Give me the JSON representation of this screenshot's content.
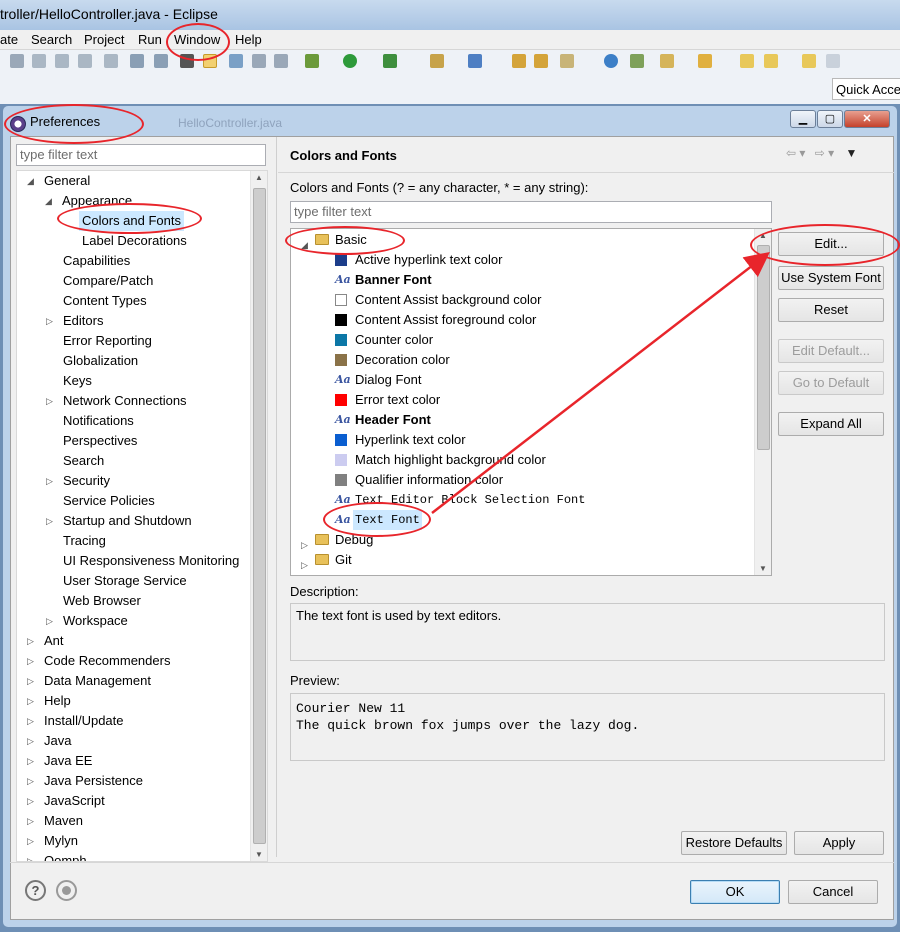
{
  "window": {
    "title": "troller/HelloController.java - Eclipse"
  },
  "menu": [
    "ate",
    "Search",
    "Project",
    "Run",
    "Window",
    "Help"
  ],
  "quick_access": "Quick Acce",
  "dialog": {
    "title": "Preferences",
    "behind_tab": "HelloController.java"
  },
  "left": {
    "filter_placeholder": "type filter text",
    "tree": [
      {
        "label": "General",
        "expanded": true
      },
      {
        "label": "Appearance",
        "expanded": true
      },
      {
        "label": "Colors and Fonts",
        "selected": true
      },
      {
        "label": "Label Decorations"
      },
      {
        "label": "Capabilities"
      },
      {
        "label": "Compare/Patch"
      },
      {
        "label": "Content Types"
      },
      {
        "label": "Editors"
      },
      {
        "label": "Error Reporting"
      },
      {
        "label": "Globalization"
      },
      {
        "label": "Keys"
      },
      {
        "label": "Network Connections"
      },
      {
        "label": "Notifications"
      },
      {
        "label": "Perspectives"
      },
      {
        "label": "Search"
      },
      {
        "label": "Security"
      },
      {
        "label": "Service Policies"
      },
      {
        "label": "Startup and Shutdown"
      },
      {
        "label": "Tracing"
      },
      {
        "label": "UI Responsiveness Monitoring"
      },
      {
        "label": "User Storage Service"
      },
      {
        "label": "Web Browser"
      },
      {
        "label": "Workspace"
      },
      {
        "label": "Ant"
      },
      {
        "label": "Code Recommenders"
      },
      {
        "label": "Data Management"
      },
      {
        "label": "Help"
      },
      {
        "label": "Install/Update"
      },
      {
        "label": "Java"
      },
      {
        "label": "Java EE"
      },
      {
        "label": "Java Persistence"
      },
      {
        "label": "JavaScript"
      },
      {
        "label": "Maven"
      },
      {
        "label": "Mylyn"
      },
      {
        "label": "Oomph"
      }
    ]
  },
  "right": {
    "page_title": "Colors and Fonts",
    "subtitle": "Colors and Fonts (? = any character, * = any string):",
    "filter_placeholder": "type filter text",
    "tree": [
      {
        "label": "Basic",
        "kind": "folder",
        "expanded": true
      },
      {
        "label": "Active hyperlink text color",
        "kind": "color",
        "color": "#1c3d8a"
      },
      {
        "label": "Banner Font",
        "kind": "font",
        "bold": true
      },
      {
        "label": "Content Assist background color",
        "kind": "color",
        "color": "#ffffff"
      },
      {
        "label": "Content Assist foreground color",
        "kind": "color",
        "color": "#000000"
      },
      {
        "label": "Counter color",
        "kind": "color",
        "color": "#0c77a6"
      },
      {
        "label": "Decoration color",
        "kind": "color",
        "color": "#8a7248"
      },
      {
        "label": "Dialog Font",
        "kind": "font"
      },
      {
        "label": "Error text color",
        "kind": "color",
        "color": "#ff0000"
      },
      {
        "label": "Header Font",
        "kind": "font",
        "bold": true
      },
      {
        "label": "Hyperlink text color",
        "kind": "color",
        "color": "#0a5ed0"
      },
      {
        "label": "Match highlight background color",
        "kind": "color",
        "color": "#ccccf0"
      },
      {
        "label": "Qualifier information color",
        "kind": "color",
        "color": "#808080"
      },
      {
        "label": "Text Editor Block Selection Font",
        "kind": "font",
        "mono": true
      },
      {
        "label": "Text Font",
        "kind": "font",
        "mono": true,
        "selected": true
      },
      {
        "label": "Debug",
        "kind": "folder"
      },
      {
        "label": "Git",
        "kind": "folder"
      }
    ],
    "buttons": {
      "edit": "Edit...",
      "use_system_font": "Use System Font",
      "reset": "Reset",
      "edit_default": "Edit Default...",
      "go_to_default": "Go to Default",
      "expand_all": "Expand All"
    },
    "description_label": "Description:",
    "description": "The text font is used by text editors.",
    "preview_label": "Preview:",
    "preview_lines": [
      "Courier New 11",
      "The quick brown fox jumps over the lazy dog."
    ],
    "restore_defaults": "Restore Defaults",
    "apply": "Apply"
  },
  "footer": {
    "ok": "OK",
    "cancel": "Cancel",
    "help_glyph": "?"
  },
  "colors": {
    "annotation": "#e8252b",
    "selection": "#cce8ff"
  }
}
